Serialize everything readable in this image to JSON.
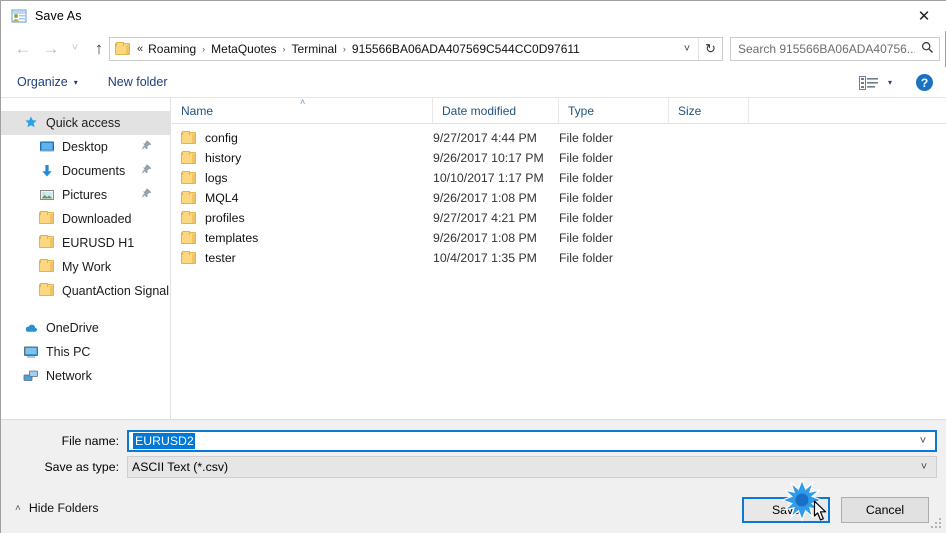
{
  "window": {
    "title": "Save As",
    "title_icon": "app-icon",
    "close_label": "✕"
  },
  "nav": {
    "back_icon": "←",
    "forward_icon": "→",
    "history_icon": "˅",
    "up_icon": "↑",
    "breadcrumb_prefix": "«",
    "breadcrumb": [
      "Roaming",
      "MetaQuotes",
      "Terminal",
      "915566BA06ADA407569C544CC0D97611"
    ],
    "separator": "›",
    "dropdown_icon": "˅",
    "refresh_icon": "↻"
  },
  "search": {
    "placeholder": "Search 915566BA06ADA40756...",
    "icon": "⌕"
  },
  "toolbar": {
    "organize_label": "Organize",
    "organize_caret": "▾",
    "new_folder_label": "New folder",
    "view_caret": "▾",
    "help_label": "?"
  },
  "sidebar": {
    "groups": [
      {
        "label": "Quick access",
        "icon": "star-icon",
        "selected": true,
        "children": [
          {
            "label": "Desktop",
            "icon": "desktop-icon",
            "pinned": true
          },
          {
            "label": "Documents",
            "icon": "documents-icon",
            "pinned": true
          },
          {
            "label": "Pictures",
            "icon": "pictures-icon",
            "pinned": true
          },
          {
            "label": "Downloaded",
            "icon": "folder-icon",
            "pinned": false
          },
          {
            "label": "EURUSD H1",
            "icon": "folder-icon",
            "pinned": false
          },
          {
            "label": "My Work",
            "icon": "folder-icon",
            "pinned": false
          },
          {
            "label": "QuantAction Signal",
            "icon": "folder-icon",
            "pinned": false
          }
        ]
      },
      {
        "label": "OneDrive",
        "icon": "onedrive-icon",
        "selected": false,
        "children": []
      },
      {
        "label": "This PC",
        "icon": "thispc-icon",
        "selected": false,
        "children": []
      },
      {
        "label": "Network",
        "icon": "network-icon",
        "selected": false,
        "children": []
      }
    ],
    "pin_icon": "📌"
  },
  "filelist": {
    "columns": [
      "Name",
      "Date modified",
      "Type",
      "Size"
    ],
    "sort_caret": "˄",
    "rows": [
      {
        "name": "config",
        "date": "9/27/2017 4:44 PM",
        "type": "File folder",
        "size": ""
      },
      {
        "name": "history",
        "date": "9/26/2017 10:17 PM",
        "type": "File folder",
        "size": ""
      },
      {
        "name": "logs",
        "date": "10/10/2017 1:17 PM",
        "type": "File folder",
        "size": ""
      },
      {
        "name": "MQL4",
        "date": "9/26/2017 1:08 PM",
        "type": "File folder",
        "size": ""
      },
      {
        "name": "profiles",
        "date": "9/27/2017 4:21 PM",
        "type": "File folder",
        "size": ""
      },
      {
        "name": "templates",
        "date": "9/26/2017 1:08 PM",
        "type": "File folder",
        "size": ""
      },
      {
        "name": "tester",
        "date": "10/4/2017 1:35 PM",
        "type": "File folder",
        "size": ""
      }
    ]
  },
  "form": {
    "filename_label": "File name:",
    "filename_value": "EURUSD2",
    "filetype_label": "Save as type:",
    "filetype_value": "ASCII Text (*.csv)",
    "dropdown_icon": "˅"
  },
  "footer": {
    "hide_folders_label": "Hide Folders",
    "hide_folders_caret": "˄",
    "save_label": "Save",
    "cancel_label": "Cancel"
  },
  "colors": {
    "accent": "#0a78d7",
    "selection": "#0078d7",
    "link": "#1f3f7a",
    "folder": "#fcd77f"
  }
}
